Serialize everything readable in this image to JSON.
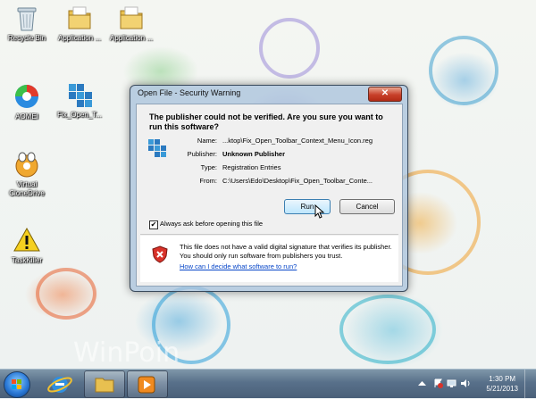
{
  "desktop": {
    "icons": [
      {
        "label": "Recycle Bin"
      },
      {
        "label": "Application ..."
      },
      {
        "label": "Application ..."
      },
      {
        "label": "AOMEI"
      },
      {
        "label": "Fix_Open_T..."
      },
      {
        "label": "Virtual CloneDrive"
      },
      {
        "label": "TaskKiller"
      }
    ],
    "watermark": "WinPoin"
  },
  "dialog": {
    "title": "Open File - Security Warning",
    "close_symbol": "✕",
    "headline": "The publisher could not be verified.  Are you sure you want to run this software?",
    "fields": [
      {
        "key": "Name:",
        "value": "...ktop\\Fix_Open_Toolbar_Context_Menu_Icon.reg"
      },
      {
        "key": "Publisher:",
        "value": "Unknown Publisher"
      },
      {
        "key": "Type:",
        "value": "Registration Entries"
      },
      {
        "key": "From:",
        "value": "C:\\Users\\Edo\\Desktop\\Fix_Open_Toolbar_Conte..."
      }
    ],
    "run_label": "Run",
    "cancel_label": "Cancel",
    "checkbox_label": "Always ask before opening this file",
    "checkbox_checked": true,
    "check_mark": "✔",
    "warning_text": "This file does not have a valid digital signature that verifies its publisher.  You should only run software from publishers you trust.",
    "warning_link": "How can I decide what software to run?"
  },
  "taskbar": {
    "time": "1:30 PM",
    "date": "5/21/2013"
  },
  "colors": {
    "taskbar": "#58708a",
    "link": "#0645c8",
    "close_button": "#c8402a"
  }
}
